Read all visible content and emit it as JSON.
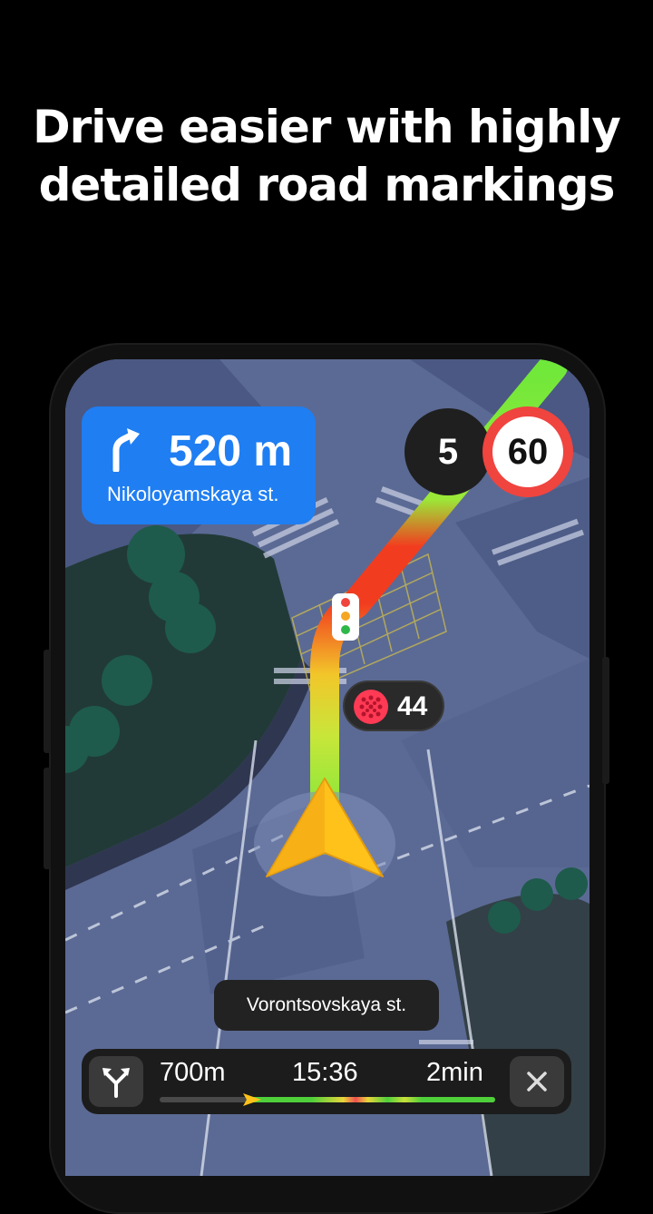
{
  "headline": {
    "line1": "Drive easier with highly",
    "line2": "detailed road markings"
  },
  "navigation": {
    "maneuver": {
      "icon": "turn-right-icon",
      "distance": "520 m",
      "street": "Nikoloyamskaya st."
    },
    "current_speed": "5",
    "speed_limit": "60",
    "traffic_light": {
      "icon": "traffic-light-icon",
      "countdown": "44"
    },
    "current_street": "Vorontsovskaya st.",
    "bottom_bar": {
      "route_options_icon": "fork-route-icon",
      "remaining_distance": "700m",
      "arrival_time": "15:36",
      "remaining_time": "2min",
      "close_icon": "close-icon",
      "progress_fraction": 0.27
    }
  },
  "colors": {
    "maneuver_bg": "#1f7ef2",
    "route_green": "#6fe83a",
    "route_red": "#f23c1f",
    "speed_limit_ring": "#f0443f",
    "arrow_yellow": "#ffc21a"
  }
}
